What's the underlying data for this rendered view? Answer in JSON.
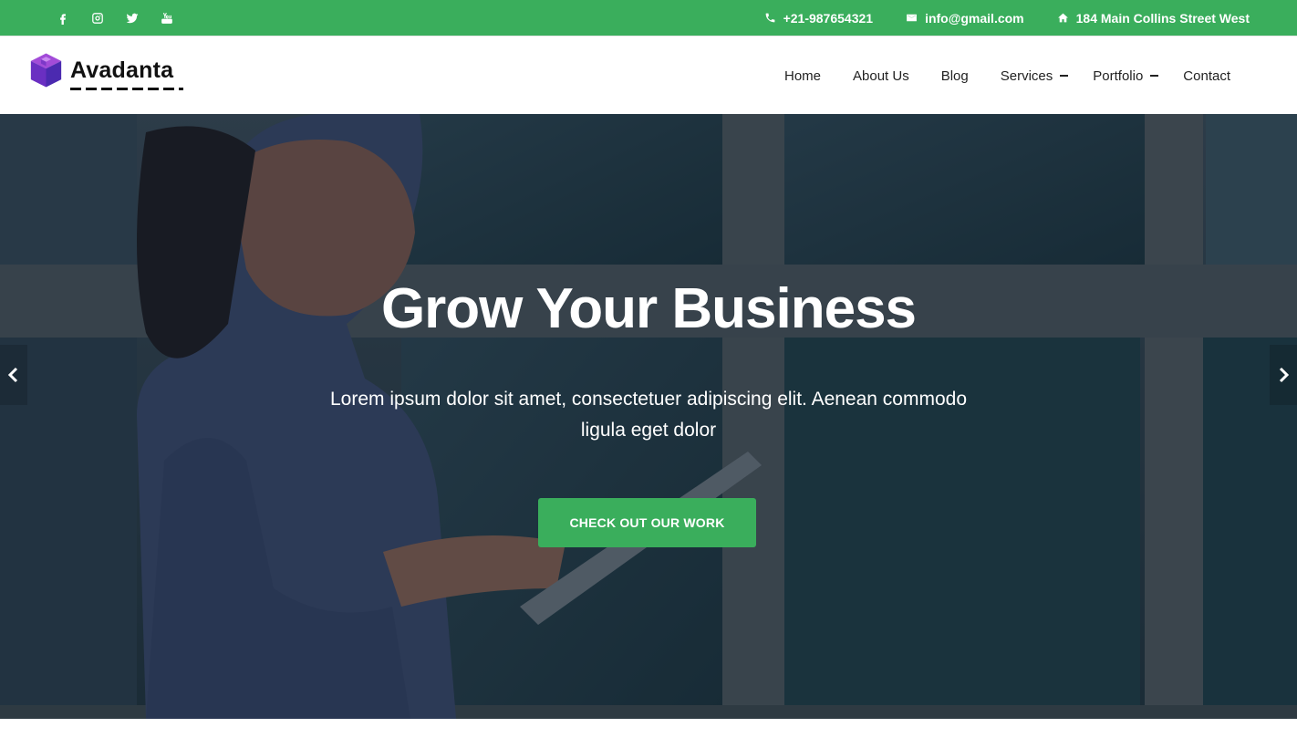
{
  "topbar": {
    "social": [
      {
        "icon": "facebook-icon"
      },
      {
        "icon": "instagram-icon"
      },
      {
        "icon": "twitter-icon"
      },
      {
        "icon": "youtube-icon"
      }
    ],
    "phone": "+21-987654321",
    "email": "info@gmail.com",
    "address": "184 Main Collins Street West",
    "background_color": "#3aae5c"
  },
  "header": {
    "brand": "Avadanta",
    "nav": [
      {
        "label": "Home"
      },
      {
        "label": "About Us"
      },
      {
        "label": "Blog"
      },
      {
        "label": "Services"
      },
      {
        "label": "Portfolio"
      },
      {
        "label": "Contact"
      }
    ]
  },
  "hero": {
    "title": "Grow Your Business",
    "subtitle": "Lorem ipsum dolor sit amet, consectetuer adipiscing elit. Aenean commodo ligula eget dolor",
    "cta_label": "CHECK OUT OUR WORK",
    "accent_color": "#3aae5c"
  }
}
